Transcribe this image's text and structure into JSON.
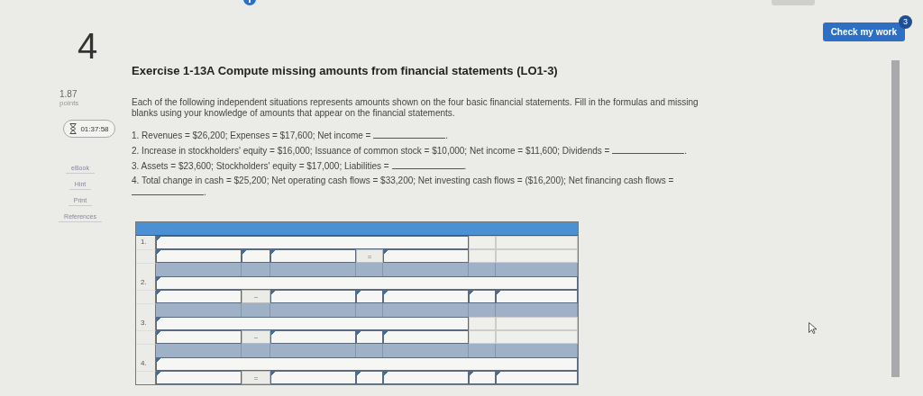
{
  "check_button": {
    "label": "Check my work",
    "badge": "3"
  },
  "question": {
    "number": "4",
    "points": "1.87",
    "points_label": "points",
    "timer": "01:37:58",
    "tools": [
      "eBook",
      "Hint",
      "Print",
      "References"
    ],
    "title": "Exercise 1-13A Compute missing amounts from financial statements (LO1-3)",
    "intro": "Each of the following independent situations represents amounts shown on the four basic financial statements. Fill in the formulas and missing blanks using your knowledge of amounts that appear on the financial statements.",
    "items": [
      {
        "text": "1. Revenues = $26,200; Expenses = $17,600; Net income = ",
        "after": "."
      },
      {
        "text": "2. Increase in stockholders' equity = $16,000; Issuance of common stock = $10,000; Net income = $11,600; Dividends = ",
        "after": "."
      },
      {
        "text": "3. Assets = $23,600; Stockholders' equity = $17,000; Liabilities = ",
        "after": "."
      },
      {
        "text": "4. Total change in cash = $25,200; Net operating cash flows = $33,200; Net investing cash flows = ($16,200); Net financing cash flows = ",
        "after": "."
      }
    ]
  },
  "table": {
    "sections": [
      {
        "number": "1.",
        "title_cells": [
          {
            "kind": "input"
          },
          {
            "kind": "empty"
          },
          {
            "kind": "empty"
          }
        ],
        "total_row": true,
        "cells": [
          {
            "kind": "input"
          },
          {
            "kind": "input"
          },
          {
            "kind": "input"
          },
          {
            "kind": "operator",
            "text": "="
          },
          {
            "kind": "input"
          },
          {
            "kind": "empty"
          },
          {
            "kind": "empty"
          }
        ]
      },
      {
        "number": "2.",
        "title_cells": [
          {
            "kind": "input"
          }
        ],
        "total_row": true,
        "cells": [
          {
            "kind": "input"
          },
          {
            "kind": "operator",
            "text": "−"
          },
          {
            "kind": "input"
          },
          {
            "kind": "input"
          },
          {
            "kind": "input"
          },
          {
            "kind": "input"
          },
          {
            "kind": "input"
          }
        ]
      },
      {
        "number": "3.",
        "title_cells": [
          {
            "kind": "input"
          },
          {
            "kind": "empty"
          },
          {
            "kind": "empty"
          }
        ],
        "total_row": true,
        "cells": [
          {
            "kind": "input"
          },
          {
            "kind": "operator",
            "text": "−"
          },
          {
            "kind": "input"
          },
          {
            "kind": "input"
          },
          {
            "kind": "input"
          },
          {
            "kind": "empty"
          },
          {
            "kind": "empty"
          }
        ]
      },
      {
        "number": "4.",
        "title_cells": [
          {
            "kind": "input"
          }
        ],
        "total_row": false,
        "cells": [
          {
            "kind": "input"
          },
          {
            "kind": "operator",
            "text": "="
          },
          {
            "kind": "input"
          },
          {
            "kind": "input"
          },
          {
            "kind": "input"
          },
          {
            "kind": "input"
          },
          {
            "kind": "input"
          }
        ]
      }
    ]
  }
}
